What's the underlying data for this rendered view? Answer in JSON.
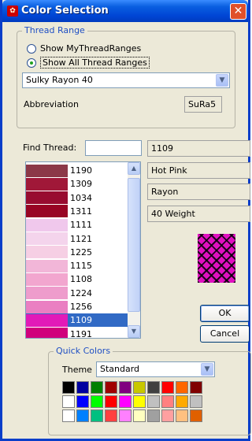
{
  "window": {
    "title": "Color Selection",
    "close_glyph": "✕",
    "app_icon": "app-icon"
  },
  "thread_range": {
    "legend": "Thread Range",
    "option_my": "Show MyThreadRanges",
    "option_all": "Show All Thread Ranges",
    "selected_option": "option_all",
    "range_select": "Sulky Rayon 40",
    "abbreviation_label": "Abbreviation",
    "abbreviation_value": "SuRa5"
  },
  "find": {
    "label": "Find Thread:",
    "value": ""
  },
  "thread_info": {
    "number": "1109",
    "name": "Hot Pink",
    "material": "Rayon",
    "weight": "40 Weight"
  },
  "thread_list": {
    "items": [
      {
        "code": "1190",
        "color": "#8c3848"
      },
      {
        "code": "1309",
        "color": "#a01838"
      },
      {
        "code": "1034",
        "color": "#980c30"
      },
      {
        "code": "1311",
        "color": "#980424"
      },
      {
        "code": "1111",
        "color": "#f0c8ec"
      },
      {
        "code": "1121",
        "color": "#f4d4ec"
      },
      {
        "code": "1225",
        "color": "#f6cfe4"
      },
      {
        "code": "1115",
        "color": "#f2b6d8"
      },
      {
        "code": "1108",
        "color": "#f2a6cf"
      },
      {
        "code": "1224",
        "color": "#ee9ccc"
      },
      {
        "code": "1256",
        "color": "#ea7fc2"
      },
      {
        "code": "1109",
        "color": "#e21ab8"
      },
      {
        "code": "1191",
        "color": "#d0007c"
      }
    ],
    "selected_code": "1109"
  },
  "buttons": {
    "ok": "OK",
    "cancel": "Cancel"
  },
  "quick_colors": {
    "legend": "Quick Colors",
    "theme_label": "Theme",
    "theme_value": "Standard",
    "palette": [
      [
        "#000000",
        "#0000a0",
        "#008000",
        "#a00000",
        "#800080",
        "#c8c800",
        "#404040",
        "#ff0000",
        "#ff6600",
        "#800000"
      ],
      [
        "#ffffff",
        "#0000ff",
        "#00ff00",
        "#ff0000",
        "#ff00ff",
        "#ffff00",
        "#c0c0c0",
        "#ff8080",
        "#ffaa00",
        "#c0c0c0"
      ],
      [
        "#ffffff",
        "#0080ff",
        "#00c080",
        "#ff4040",
        "#ff80ff",
        "#ffffc0",
        "#a0a0a0",
        "#ffa0a0",
        "#ffc080",
        "#e06000"
      ]
    ]
  }
}
